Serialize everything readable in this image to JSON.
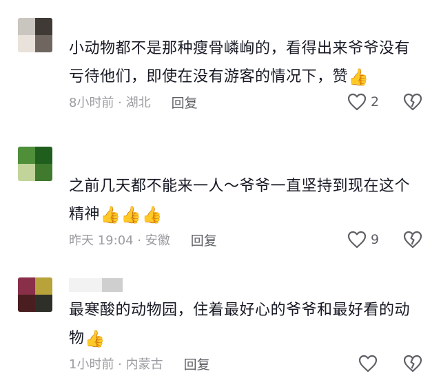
{
  "comments": [
    {
      "text": "小动物都不是那种瘦骨嶙峋的，看得出来爷爷没有亏待他们，即使在没有游客的情况下，赞",
      "thumbs": "👍",
      "time_location": "8小时前 · 湖北",
      "reply_label": "回复",
      "like_count": "2",
      "avatar_colors": [
        "#c9c5bf",
        "#3f3a36",
        "#e8e2da",
        "#6e665f"
      ]
    },
    {
      "text": "之前几天都不能来一人～爷爷一直坚持到现在这个精神",
      "thumbs": "👍👍👍",
      "time_location": "昨天 19:04 · 安徽",
      "reply_label": "回复",
      "like_count": "9",
      "avatar_colors": [
        "#4f8f3a",
        "#1f5e1c",
        "#c2d49a",
        "#3f7a2e"
      ]
    },
    {
      "text": "最寒酸的动物园，住着最好心的爷爷和最好看的动物",
      "thumbs": "👍",
      "time_location": "1小时前 · 内蒙古",
      "reply_label": "回复",
      "like_count": "",
      "avatar_colors": [
        "#8a2f4a",
        "#b8a23a",
        "#4a1e20",
        "#2f2f2a"
      ]
    }
  ],
  "icons": {
    "like": "heart-outline-icon",
    "dislike": "broken-heart-icon"
  }
}
